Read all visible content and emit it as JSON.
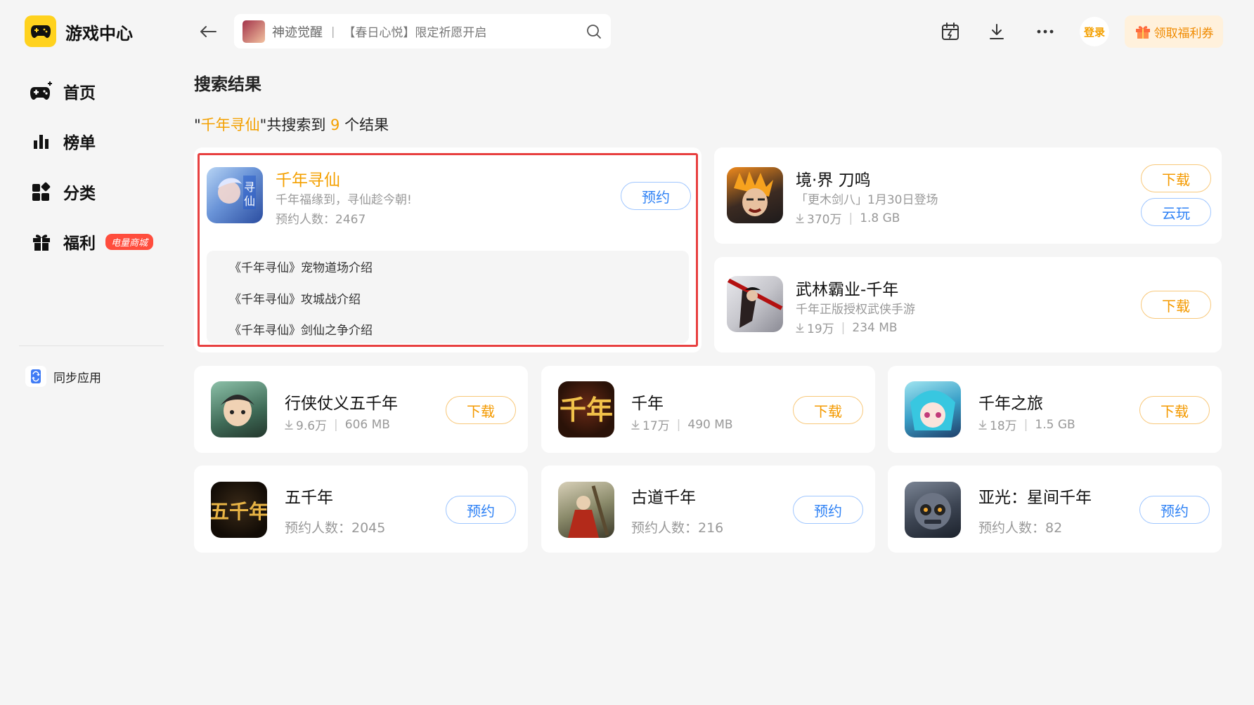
{
  "app": {
    "name": "游戏中心"
  },
  "nav": [
    {
      "label": "首页"
    },
    {
      "label": "榜单"
    },
    {
      "label": "分类"
    },
    {
      "label": "福利",
      "badge": "电量商城"
    }
  ],
  "sync": {
    "label": "同步应用"
  },
  "search": {
    "game": "神迹觉醒",
    "promo": "【春日心悦】限定祈愿开启"
  },
  "header": {
    "login": "登录",
    "coupon": "领取福利券"
  },
  "page": {
    "title": "搜索结果",
    "summary": {
      "open_quote": "\"",
      "query": "千年寻仙",
      "mid": "\"共搜索到 ",
      "count": "9",
      "suffix": " 个结果"
    }
  },
  "featured": {
    "name": "千年寻仙",
    "desc": "千年福缘到，寻仙趁今朝!",
    "reserve": "预约人数：2467",
    "button": "预约",
    "articles": [
      "《千年寻仙》宠物道场介绍",
      "《千年寻仙》攻城战介绍",
      "《千年寻仙》剑仙之争介绍"
    ]
  },
  "right_cards": [
    {
      "name": "境·界 刀鸣",
      "desc": "「更木剑八」1月30日登场",
      "downloads": "370万",
      "size": "1.8 GB",
      "button": "下载",
      "button2": "云玩"
    },
    {
      "name": "武林霸业-千年",
      "desc": "千年正版授权武侠手游",
      "downloads": "19万",
      "size": "234 MB",
      "button": "下载"
    }
  ],
  "grid": [
    {
      "name": "行侠仗义五千年",
      "downloads": "9.6万",
      "size": "606 MB",
      "button": "下载"
    },
    {
      "name": "千年",
      "downloads": "17万",
      "size": "490 MB",
      "button": "下载"
    },
    {
      "name": "千年之旅",
      "downloads": "18万",
      "size": "1.5 GB",
      "button": "下载"
    },
    {
      "name": "五千年",
      "reserve": "预约人数：2045",
      "button": "预约"
    },
    {
      "name": "古道千年",
      "reserve": "预约人数：216",
      "button": "预约"
    },
    {
      "name": "亚光：星间千年",
      "reserve": "预约人数：82",
      "button": "预约"
    }
  ],
  "colors": {
    "accent": "#f4a000",
    "highlight_border": "#e84040",
    "reserve_blue": "#2f82f5",
    "badge_red": "#ff4d3d"
  }
}
